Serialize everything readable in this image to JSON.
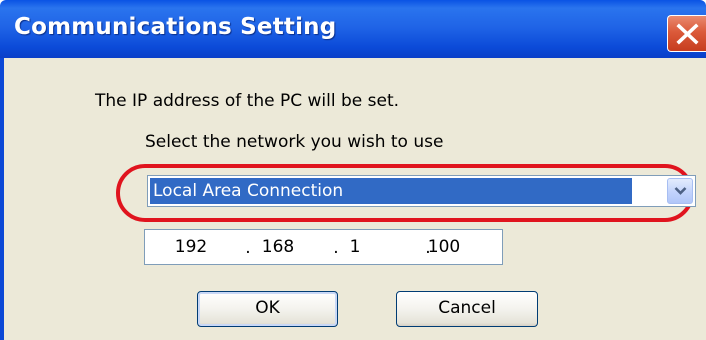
{
  "window": {
    "title": "Communications Setting"
  },
  "dialog": {
    "message": "The IP address of the PC will be set.",
    "network_prompt": "Select the network you wish to use",
    "network_select": {
      "selected": "Local Area Connection"
    },
    "ip_address": {
      "octet1": "192",
      "octet2": "168",
      "octet3": "1",
      "octet4": "100",
      "separator": "."
    },
    "buttons": {
      "ok": "OK",
      "cancel": "Cancel"
    }
  },
  "colors": {
    "titlebar": "#0b4ad8",
    "dialog_bg": "#ece9d8",
    "selection": "#316ac5",
    "highlight_ring": "#e0141e",
    "close_button": "#db5a3a"
  },
  "icons": {
    "close": "close-icon",
    "dropdown": "chevron-down-icon"
  }
}
